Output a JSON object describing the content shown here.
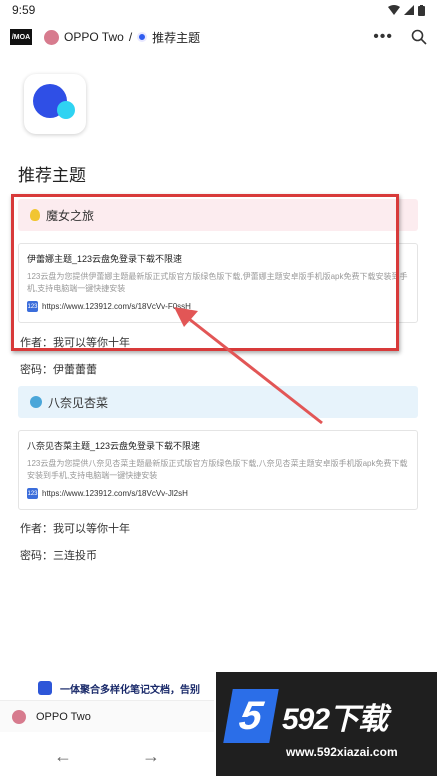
{
  "status": {
    "time": "9:59"
  },
  "header": {
    "logo": "/MOA",
    "crumb_workspace": "OPPO Two",
    "crumb_sep": "/",
    "crumb_page": "推荐主题"
  },
  "page": {
    "title": "推荐主题"
  },
  "sections": [
    {
      "callout": "魔女之旅",
      "bookmark": {
        "title": "伊蕾娜主题_123云盘免登录下载不限速",
        "desc": "123云盘为您提供伊蕾娜主题最新版正式版官方版绿色版下载,伊蕾娜主题安卓版手机版apk免费下载安装到手机,支持电脑端一键快捷安装",
        "fav": "123",
        "url": "https://www.123912.com/s/18VcVv-F0ssH"
      },
      "author": "作者：我可以等你十年",
      "password": "密码：伊蕾蕾蕾"
    },
    {
      "callout": "八奈见杏菜",
      "bookmark": {
        "title": "八奈见杏菜主题_123云盘免登录下载不限速",
        "desc": "123云盘为您提供八奈见杏菜主题最新版正式版官方版绿色版下载,八奈见杏菜主题安卓版手机版apk免费下载安装到手机,支持电脑端一键快捷安装",
        "fav": "123",
        "url": "https://www.123912.com/s/18VcVv-Jl2sH"
      },
      "author": "作者：我可以等你十年",
      "password": "密码：三连投币"
    }
  ],
  "banner": {
    "text": "一体聚合多样化笔记文档，告别"
  },
  "tabstrip": {
    "label": "OPPO Two"
  },
  "nav": {
    "back": "←",
    "forward": "→"
  },
  "watermark": {
    "digit": "5",
    "brand": "592下载",
    "url": "www.592xiazai.com"
  },
  "colors": {
    "accent": "#2f4fe6",
    "highlight": "#d83a3a",
    "callout_pink": "#fcecef",
    "callout_blue": "#e7f3fb"
  }
}
